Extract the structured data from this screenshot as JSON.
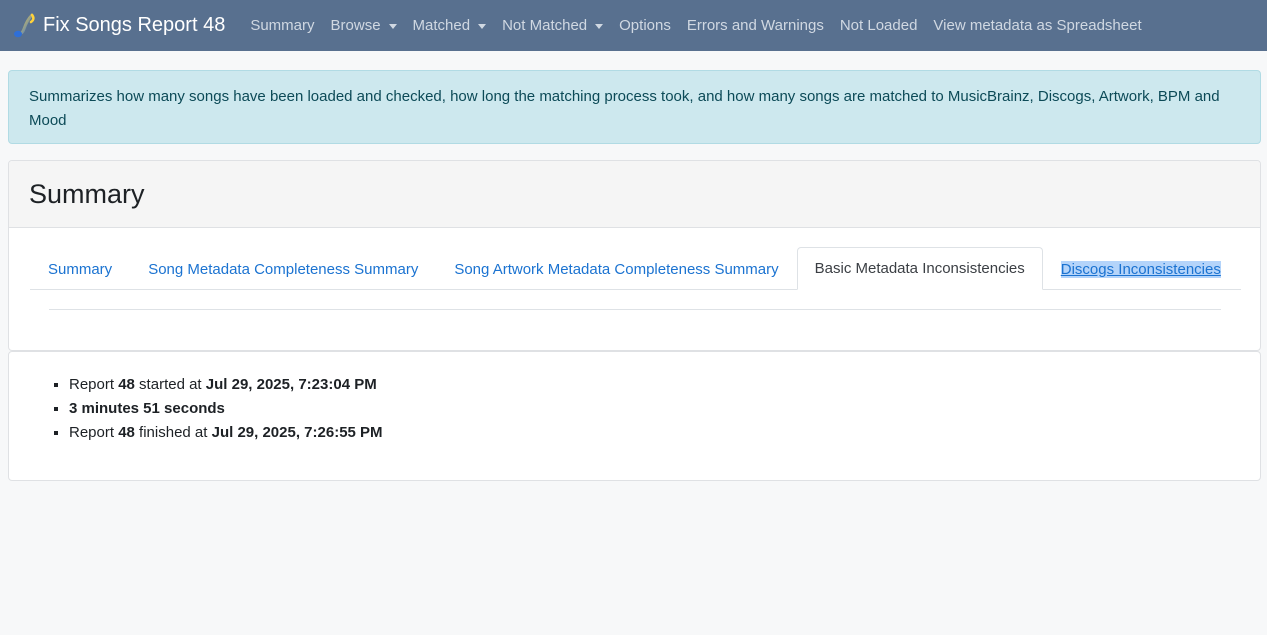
{
  "navbar": {
    "brand": "Fix Songs Report 48",
    "logo_icon": "music-note-icon",
    "links": [
      {
        "label": "Summary",
        "dropdown": false
      },
      {
        "label": "Browse",
        "dropdown": true
      },
      {
        "label": "Matched",
        "dropdown": true
      },
      {
        "label": "Not Matched",
        "dropdown": true
      },
      {
        "label": "Options",
        "dropdown": false
      },
      {
        "label": "Errors and Warnings",
        "dropdown": false
      },
      {
        "label": "Not Loaded",
        "dropdown": false
      },
      {
        "label": "View metadata as Spreadsheet",
        "dropdown": false
      }
    ]
  },
  "alert": {
    "text": "Summarizes how many songs have been loaded and checked, how long the matching process took, and how many songs are matched to MusicBrainz, Discogs, Artwork, BPM and Mood"
  },
  "card": {
    "title": "Summary",
    "tabs": [
      {
        "label": "Summary",
        "active": false
      },
      {
        "label": "Song Metadata Completeness Summary",
        "active": false
      },
      {
        "label": "Song Artwork Metadata Completeness Summary",
        "active": false
      },
      {
        "label": "Basic Metadata Inconsistencies",
        "active": true
      },
      {
        "label": "Discogs Inconsistencies",
        "active": false
      }
    ]
  },
  "report": {
    "started": {
      "prefix": "Report ",
      "number": "48",
      "middle": " started at ",
      "time": "Jul 29, 2025, 7:23:04 PM"
    },
    "duration": "3 minutes 51 seconds",
    "finished": {
      "prefix": "Report ",
      "number": "48",
      "middle": " finished at ",
      "time": "Jul 29, 2025, 7:26:55 PM"
    }
  },
  "colors": {
    "navbar_bg": "#58708f",
    "alert_bg": "#cde8ee",
    "link": "#1b73d1"
  }
}
